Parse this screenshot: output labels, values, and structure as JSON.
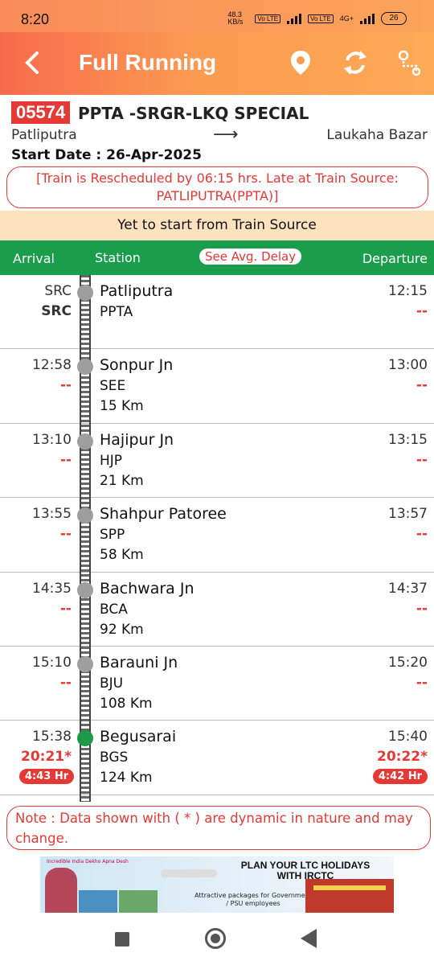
{
  "status_bar": {
    "time": "8:20",
    "speed": "48.3 KB/s",
    "net1": "Vo LTE",
    "net2": "Vo LTE",
    "gen": "4G+",
    "battery": "26"
  },
  "header": {
    "title": "Full Running",
    "icons": [
      "back-arrow-icon",
      "location-pin-icon",
      "refresh-icon",
      "route-map-icon"
    ]
  },
  "train": {
    "number": "05574",
    "name": "PPTA -SRGR-LKQ SPECIAL",
    "from": "Patliputra",
    "arrow": "⟶",
    "to": "Laukaha Bazar",
    "start_date": "Start Date : 26-Apr-2025",
    "reschedule_note": "[Train is Rescheduled by 06:15 hrs. Late at Train Source: PATLIPUTRA(PPTA)]"
  },
  "status_strip": "Yet to start from Train Source",
  "table_header": {
    "arrival": "Arrival",
    "station": "Station",
    "avg_delay": "See Avg. Delay",
    "departure": "Departure"
  },
  "stations": [
    {
      "arr": "SRC",
      "arr_act": "SRC",
      "name": "Patliputra",
      "code": "PPTA",
      "km": "",
      "dep": "12:15",
      "dep_act": "--",
      "arr_delay": "",
      "dep_delay": "",
      "reached": false
    },
    {
      "arr": "12:58",
      "arr_act": "--",
      "name": "Sonpur Jn",
      "code": "SEE",
      "km": "15 Km",
      "dep": "13:00",
      "dep_act": "--",
      "arr_delay": "",
      "dep_delay": "",
      "reached": false
    },
    {
      "arr": "13:10",
      "arr_act": "--",
      "name": "Hajipur Jn",
      "code": "HJP",
      "km": "21 Km",
      "dep": "13:15",
      "dep_act": "--",
      "arr_delay": "",
      "dep_delay": "",
      "reached": false
    },
    {
      "arr": "13:55",
      "arr_act": "--",
      "name": "Shahpur Patoree",
      "code": "SPP",
      "km": "58 Km",
      "dep": "13:57",
      "dep_act": "--",
      "arr_delay": "",
      "dep_delay": "",
      "reached": false
    },
    {
      "arr": "14:35",
      "arr_act": "--",
      "name": "Bachwara Jn",
      "code": "BCA",
      "km": "92 Km",
      "dep": "14:37",
      "dep_act": "--",
      "arr_delay": "",
      "dep_delay": "",
      "reached": false
    },
    {
      "arr": "15:10",
      "arr_act": "--",
      "name": "Barauni Jn",
      "code": "BJU",
      "km": "108 Km",
      "dep": "15:20",
      "dep_act": "--",
      "arr_delay": "",
      "dep_delay": "",
      "reached": false
    },
    {
      "arr": "15:38",
      "arr_act": "20:21*",
      "name": "Begusarai",
      "code": "BGS",
      "km": "124 Km",
      "dep": "15:40",
      "dep_act": "20:22*",
      "arr_delay": "4:43 Hr",
      "dep_delay": "4:42 Hr",
      "reached": true
    }
  ],
  "note": "Note : Data shown with ( * ) are dynamic in nature and may change.",
  "ad": {
    "brand": "Incredible India Dekho Apna Desh",
    "headline": "PLAN YOUR LTC HOLIDAYS WITH IRCTC",
    "sub": "Attractive packages for Government / PSU employees"
  },
  "colors": {
    "accent_red": "#e53935",
    "header_green": "#1a9e4b",
    "strip_bg": "#fde2c0",
    "appbar_gradient_start": "#f76b4c",
    "appbar_gradient_end": "#fdaa55"
  }
}
